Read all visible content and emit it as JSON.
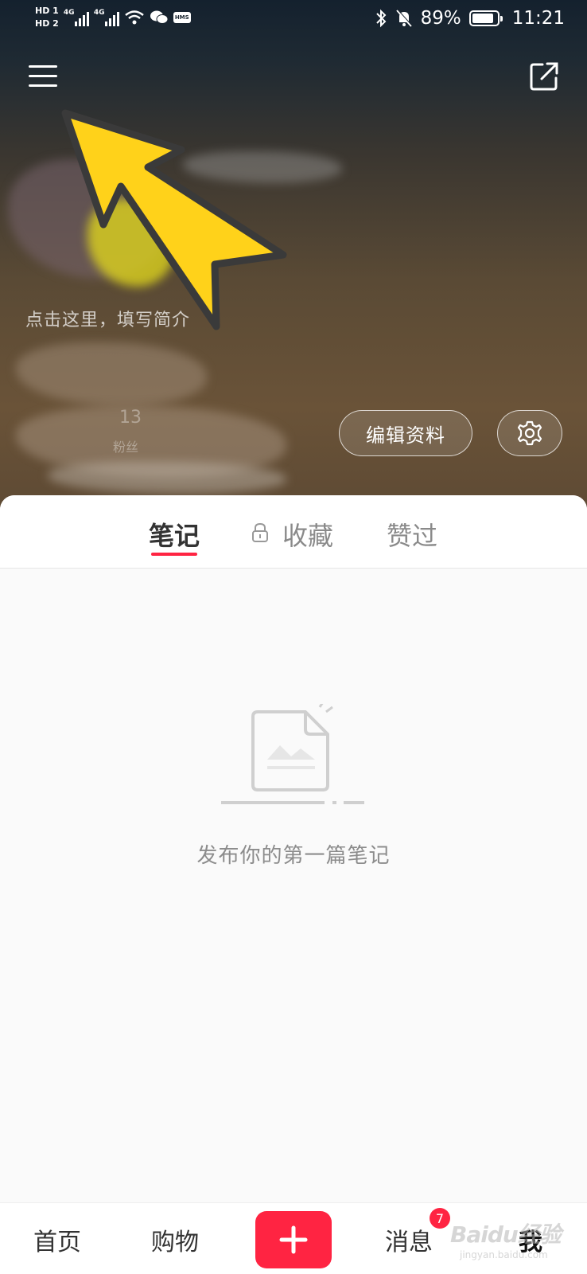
{
  "status_bar": {
    "hd1": "HD 1",
    "hd2": "HD 2",
    "network1": "4G",
    "network2": "4G",
    "hms": "HMS",
    "battery": "89%",
    "battery_level": 0.89,
    "time": "11:21"
  },
  "profile": {
    "bio_placeholder": "点击这里，填写简介",
    "stat_count": "13",
    "stat_label": "粉丝",
    "edit_button": "编辑资料"
  },
  "tabs": [
    {
      "label": "笔记",
      "active": true
    },
    {
      "label": "收藏",
      "active": false
    },
    {
      "label": "赞过",
      "active": false
    }
  ],
  "empty_state": {
    "message": "发布你的第一篇笔记"
  },
  "bottom_nav": {
    "home": "首页",
    "shop": "购物",
    "messages": "消息",
    "messages_badge": "7",
    "me": "我"
  },
  "watermark": {
    "brand": "Baidu经验",
    "url": "jingyan.baidu.com"
  },
  "colors": {
    "accent": "#ff2442",
    "arrow": "#ffd21a"
  },
  "icons": [
    "menu-icon",
    "share-icon",
    "gear-icon",
    "lock-icon",
    "plus-icon",
    "empty-note-icon"
  ]
}
